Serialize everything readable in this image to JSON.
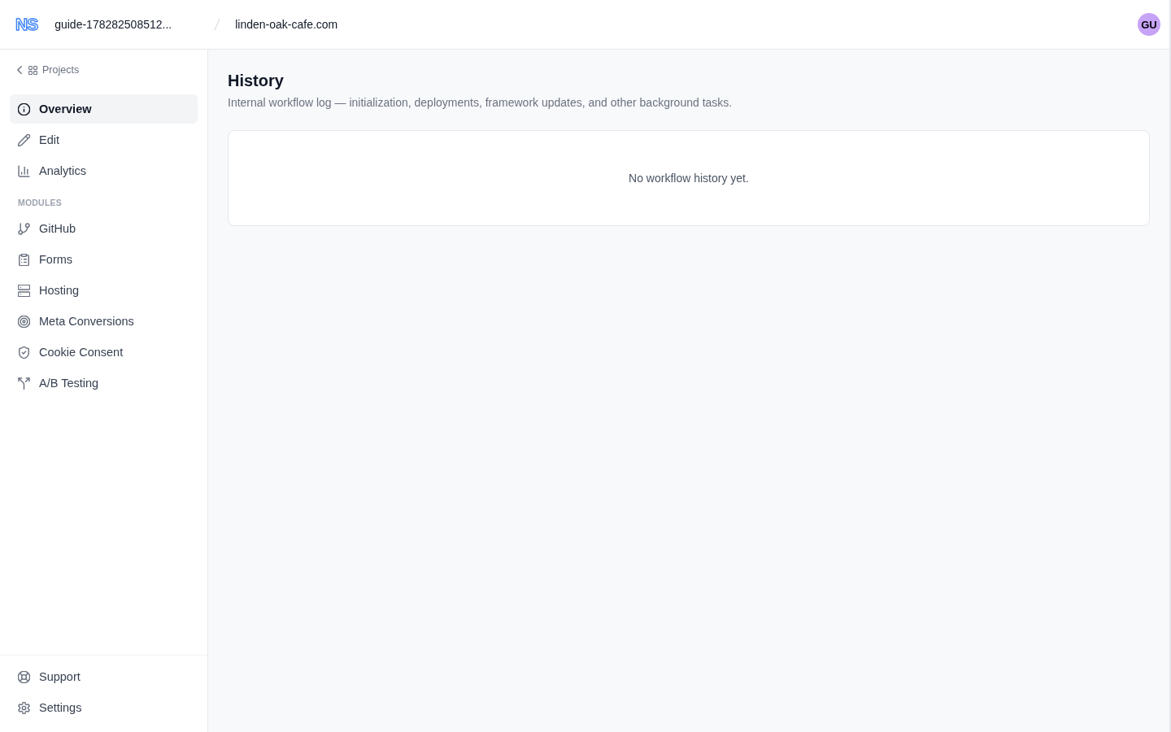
{
  "header": {
    "logo": "NS",
    "project": "guide-178282508512...",
    "site": "linden-oak-cafe.com",
    "avatar": "GU"
  },
  "sidebar": {
    "back_link": "Projects",
    "items": [
      {
        "label": "Overview",
        "selected": true
      },
      {
        "label": "Edit",
        "selected": false
      },
      {
        "label": "Analytics",
        "selected": false
      }
    ],
    "section_title": "MODULES",
    "modules": [
      {
        "label": "GitHub",
        "selected": false
      },
      {
        "label": "Forms",
        "selected": false
      },
      {
        "label": "Hosting",
        "selected": false
      },
      {
        "label": "Meta Conversions",
        "selected": false
      },
      {
        "label": "Cookie Consent",
        "selected": false
      },
      {
        "label": "A/B Testing",
        "selected": false
      }
    ],
    "footer_items": [
      {
        "label": "Support",
        "selected": false
      },
      {
        "label": "Settings",
        "selected": false
      }
    ]
  },
  "main": {
    "title": "History",
    "description": "Internal workflow log — initialization, deployments, framework updates, and other background tasks.",
    "empty_state": "No workflow history yet."
  }
}
